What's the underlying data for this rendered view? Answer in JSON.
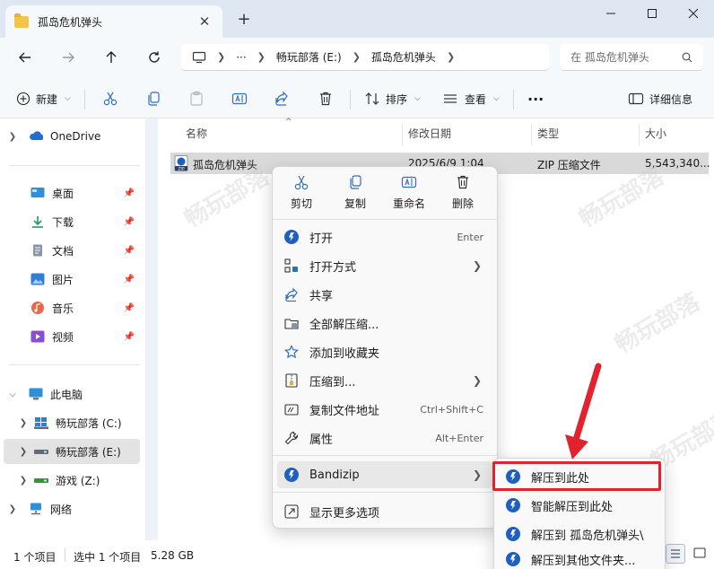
{
  "tab": {
    "title": "孤岛危机弹头",
    "close": "✕",
    "new_tab": "+"
  },
  "address": {
    "more": "···",
    "crumbs": [
      "畅玩部落 (E:)",
      "孤岛危机弹头"
    ]
  },
  "search": {
    "placeholder": "在 孤岛危机弹头 中搜索"
  },
  "search_visible_text": "在 孤岛危机弹头",
  "commands": {
    "new": "新建",
    "sort": "排序",
    "view": "查看",
    "more": "···",
    "details": "详细信息"
  },
  "sidebar": {
    "onedrive": "OneDrive",
    "quick": [
      {
        "label": "桌面",
        "icon": "desktop-icon"
      },
      {
        "label": "下载",
        "icon": "download-icon"
      },
      {
        "label": "文档",
        "icon": "document-icon"
      },
      {
        "label": "图片",
        "icon": "pictures-icon"
      },
      {
        "label": "音乐",
        "icon": "music-icon"
      },
      {
        "label": "视频",
        "icon": "video-icon"
      }
    ],
    "this_pc": "此电脑",
    "drives": [
      {
        "label": "畅玩部落 (C:)",
        "selected": false
      },
      {
        "label": "畅玩部落 (E:)",
        "selected": true
      },
      {
        "label": "游戏 (Z:)",
        "selected": false
      }
    ],
    "network": "网络"
  },
  "columns": {
    "name": "名称",
    "modified": "修改日期",
    "type": "类型",
    "size": "大小"
  },
  "file": {
    "name": "孤岛危机弹头",
    "modified": "2025/6/9 1:04",
    "type": "ZIP 压缩文件",
    "size": "5,543,340..."
  },
  "status": {
    "count": "1 个项目",
    "selected": "选中 1 个项目",
    "size": "5.28 GB"
  },
  "context_menu": {
    "quick_actions": {
      "cut": "剪切",
      "copy": "复制",
      "rename": "重命名",
      "delete": "删除"
    },
    "items": {
      "open": {
        "label": "打开",
        "shortcut": "Enter"
      },
      "open_with": {
        "label": "打开方式"
      },
      "share": {
        "label": "共享"
      },
      "extract_all": {
        "label": "全部解压缩..."
      },
      "favorite": {
        "label": "添加到收藏夹"
      },
      "compress": {
        "label": "压缩到..."
      },
      "copy_path": {
        "label": "复制文件地址",
        "shortcut": "Ctrl+Shift+C"
      },
      "properties": {
        "label": "属性",
        "shortcut": "Alt+Enter"
      },
      "bandizip": {
        "label": "Bandizip"
      },
      "more": {
        "label": "显示更多选项"
      }
    },
    "submenu": [
      "解压到此处",
      "智能解压到此处",
      "解压到 孤岛危机弹头\\",
      "解压到其他文件夹..."
    ]
  },
  "watermark": "畅玩部落",
  "colors": {
    "accent": "#1f5fbf",
    "highlight_box": "#e0232d",
    "arrow": "#e0232d"
  }
}
